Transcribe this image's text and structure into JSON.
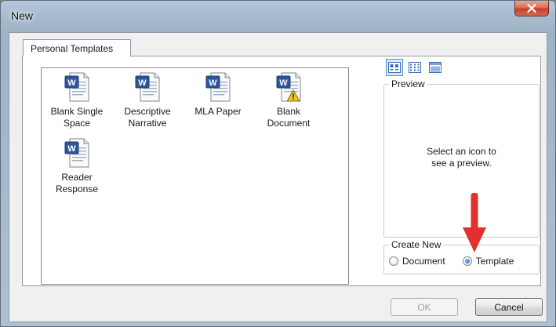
{
  "window": {
    "title": "New"
  },
  "tabs": [
    {
      "label": "Personal Templates"
    }
  ],
  "templates": [
    {
      "label": "Blank Single\nSpace",
      "icon": "word-document-icon"
    },
    {
      "label": "Descriptive\nNarrative",
      "icon": "word-document-icon"
    },
    {
      "label": "MLA Paper",
      "icon": "word-document-icon"
    },
    {
      "label": "Blank\nDocument",
      "icon": "word-document-warning-icon"
    },
    {
      "label": "Reader\nResponse",
      "icon": "word-document-icon"
    }
  ],
  "view_buttons": [
    {
      "icon": "large-icons-view-icon",
      "active": true
    },
    {
      "icon": "list-view-icon",
      "active": false
    },
    {
      "icon": "details-view-icon",
      "active": false
    }
  ],
  "preview": {
    "label": "Preview",
    "text": "Select an icon to\nsee a preview."
  },
  "create_new": {
    "label": "Create New",
    "options": [
      {
        "label": "Document",
        "checked": false
      },
      {
        "label": "Template",
        "checked": true
      }
    ]
  },
  "buttons": {
    "ok": "OK",
    "cancel": "Cancel"
  },
  "colors": {
    "arrow": "#e03030",
    "accent": "#2b579a"
  }
}
